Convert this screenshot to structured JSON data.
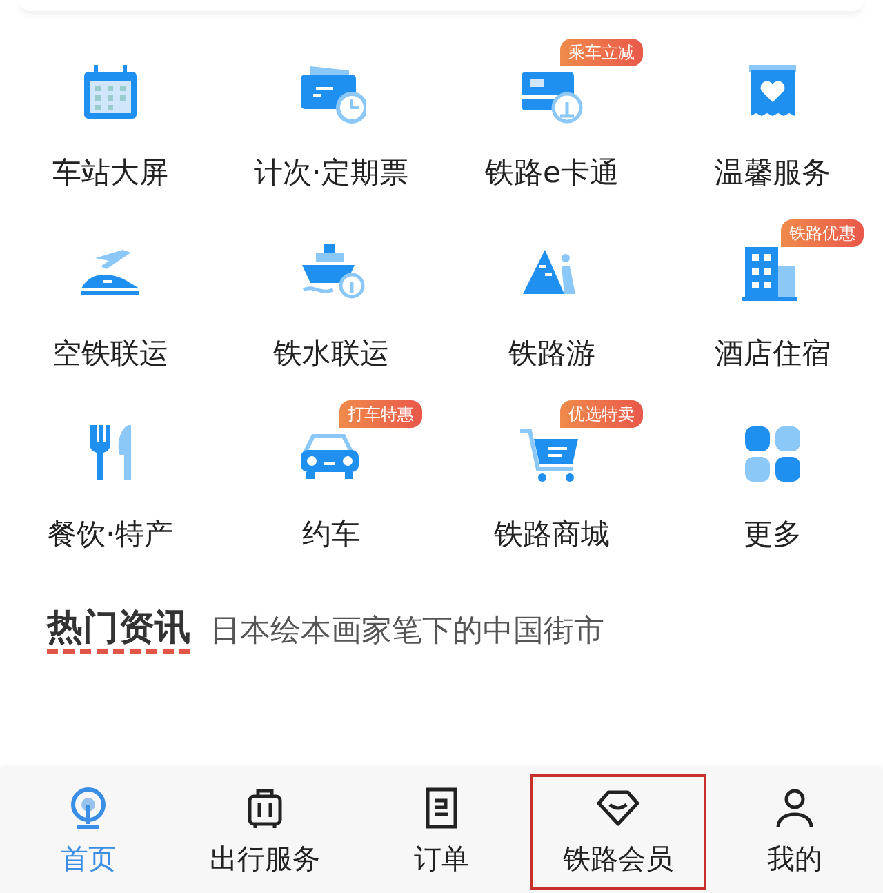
{
  "services": [
    {
      "label": "车站大屏"
    },
    {
      "label": "计次·定期票"
    },
    {
      "label": "铁路e卡通",
      "badge": "乘车立减"
    },
    {
      "label": "温馨服务"
    },
    {
      "label": "空铁联运"
    },
    {
      "label": "铁水联运"
    },
    {
      "label": "铁路游"
    },
    {
      "label": "酒店住宿",
      "badge": "铁路优惠"
    },
    {
      "label": "餐饮·特产"
    },
    {
      "label": "约车",
      "badge": "打车特惠"
    },
    {
      "label": "铁路商城",
      "badge": "优选特卖"
    },
    {
      "label": "更多"
    }
  ],
  "news": {
    "heading": "热门资讯",
    "headline": "日本绘本画家笔下的中国街市"
  },
  "tab_bar": [
    {
      "label": "首页",
      "selected": true,
      "highlighted": false
    },
    {
      "label": "出行服务",
      "selected": false,
      "highlighted": false
    },
    {
      "label": "订单",
      "selected": false,
      "highlighted": false
    },
    {
      "label": "铁路会员",
      "selected": false,
      "highlighted": true
    },
    {
      "label": "我的",
      "selected": false,
      "highlighted": false
    }
  ]
}
